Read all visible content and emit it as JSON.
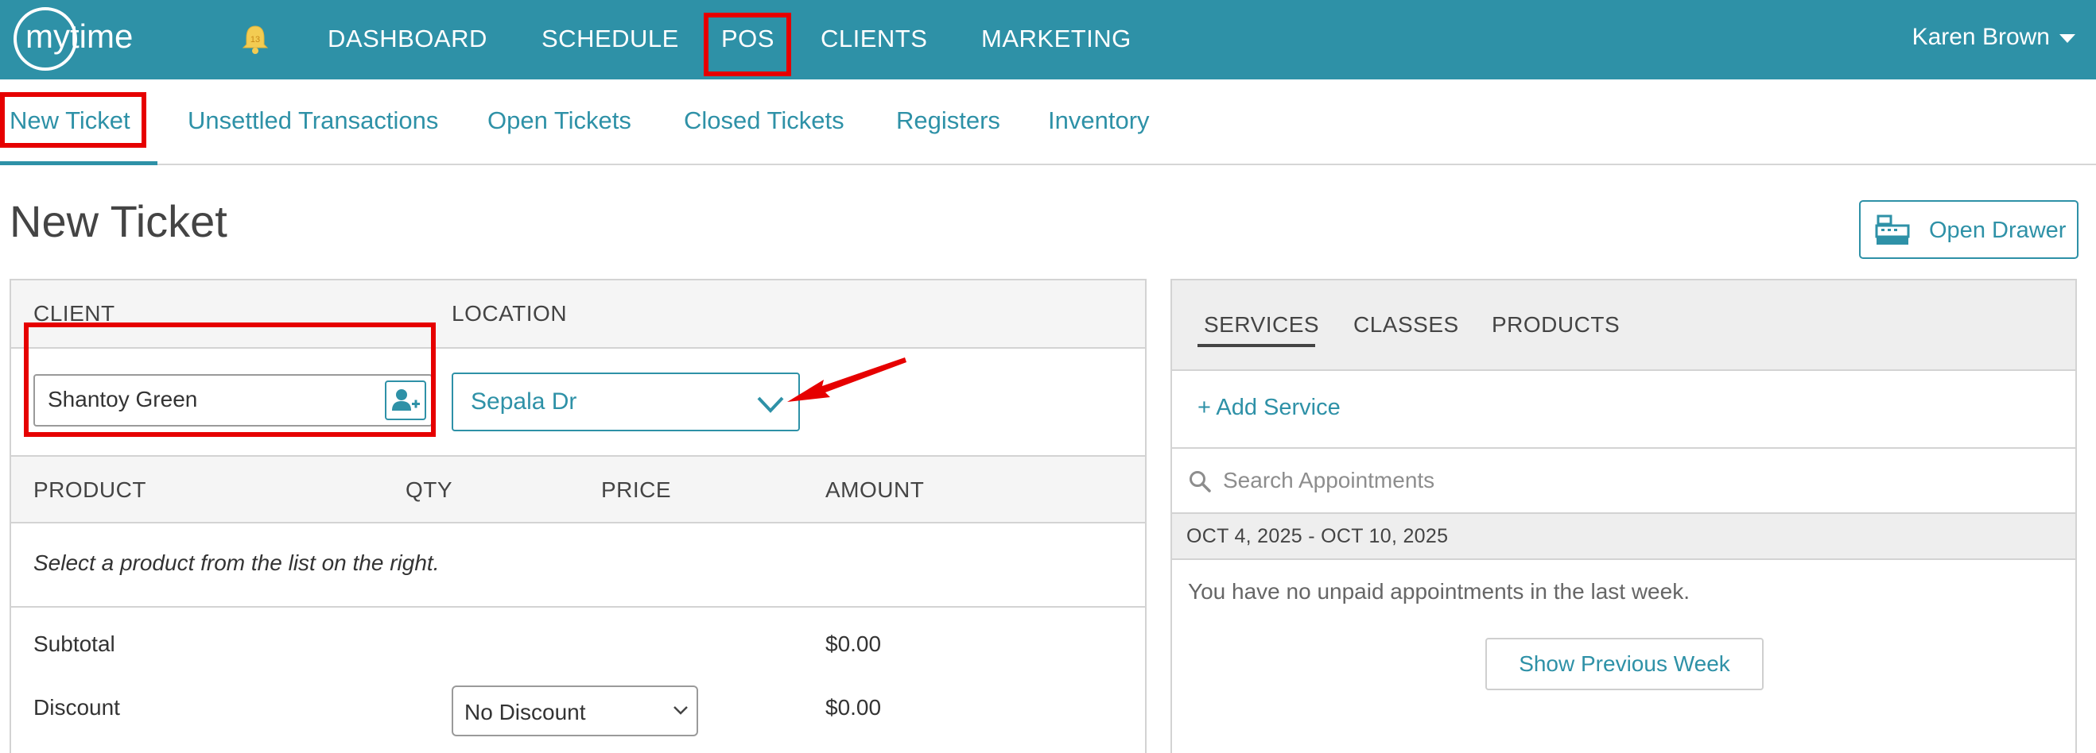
{
  "app": {
    "logo_text": "mytime",
    "notification_count": "13"
  },
  "topnav": {
    "items": [
      "DASHBOARD",
      "SCHEDULE",
      "POS",
      "CLIENTS",
      "MARKETING"
    ],
    "active": "POS",
    "user_name": "Karen Brown"
  },
  "subnav": {
    "items": [
      "New Ticket",
      "Unsettled Transactions",
      "Open Tickets",
      "Closed Tickets",
      "Registers",
      "Inventory"
    ],
    "active": "New Ticket"
  },
  "page": {
    "title": "New Ticket",
    "open_drawer_label": "Open Drawer"
  },
  "ticket": {
    "client_header": "CLIENT",
    "location_header": "LOCATION",
    "client_value": "Shantoy Green",
    "location_value": "Sepala Dr",
    "columns": [
      "PRODUCT",
      "QTY",
      "PRICE",
      "AMOUNT"
    ],
    "empty_message": "Select a product from the list on the right.",
    "subtotal_label": "Subtotal",
    "subtotal_amount": "$0.00",
    "discount_label": "Discount",
    "discount_value": "No Discount",
    "discount_amount": "$0.00"
  },
  "catalog": {
    "tabs": [
      "SERVICES",
      "CLASSES",
      "PRODUCTS"
    ],
    "active_tab": "SERVICES",
    "add_service_label": "+ Add Service",
    "search_placeholder": "Search Appointments",
    "date_range": "OCT 4, 2025 - OCT 10, 2025",
    "no_unpaid_message": "You have no unpaid appointments in the last week.",
    "show_previous_week_label": "Show Previous Week"
  },
  "colors": {
    "brand_teal": "#2e91a7",
    "highlight_red": "#e60000",
    "header_gray": "#f5f5f5",
    "border_gray": "#d3d3d3"
  }
}
